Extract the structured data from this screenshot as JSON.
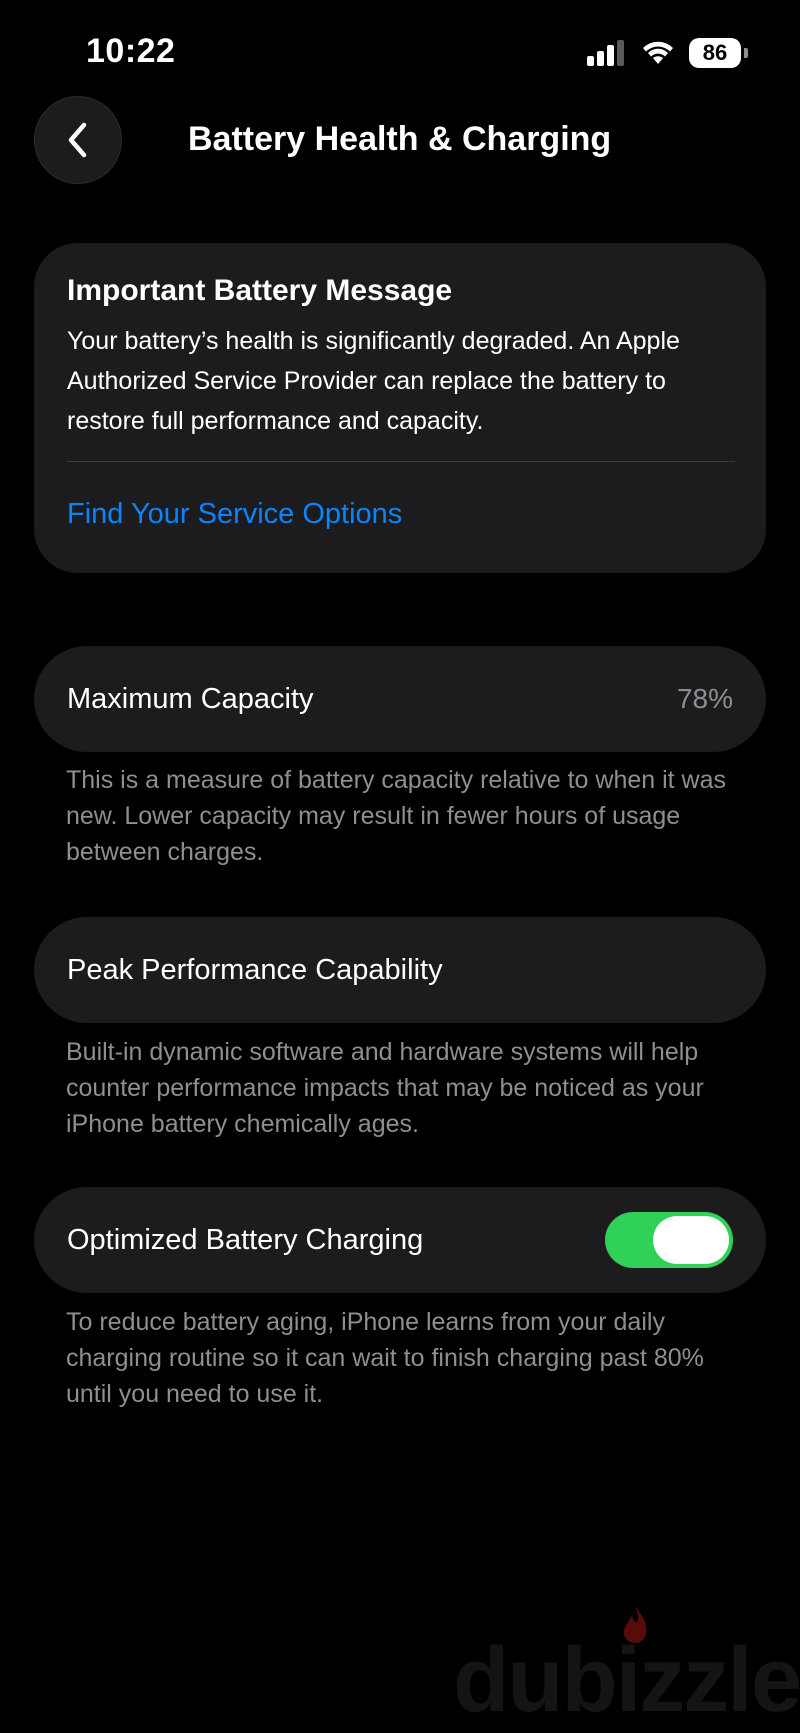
{
  "status_bar": {
    "time": "10:22",
    "battery_level": "86",
    "icons": [
      "signal-icon",
      "wifi-icon",
      "battery-icon"
    ]
  },
  "nav": {
    "back_icon": "chevron-left-icon",
    "title": "Battery Health & Charging"
  },
  "battery_message": {
    "title": "Important Battery Message",
    "body": "Your battery’s health is significantly degraded. An Apple Authorized Service Provider can replace the battery to restore full performance and capacity.",
    "link": "Find Your Service Options"
  },
  "maximum_capacity": {
    "label": "Maximum Capacity",
    "value": "78%",
    "caption": "This is a measure of battery capacity relative to when it was new. Lower capacity may result in fewer hours of usage between charges."
  },
  "peak_performance": {
    "label": "Peak Performance Capability",
    "caption": "Built-in dynamic software and hardware systems will help counter performance impacts that may be noticed as your iPhone battery chemically ages."
  },
  "optimized_charging": {
    "label": "Optimized Battery Charging",
    "enabled": true,
    "caption": "To reduce battery aging, iPhone learns from your daily charging routine so it can wait to finish charging past 80% until you need to use it."
  },
  "watermark": {
    "text": "dubizzle"
  },
  "colors": {
    "background": "#000000",
    "card": "#1c1c1e",
    "link": "#0a84ff",
    "toggle_on": "#30d158",
    "secondary_text": "#8e8e93"
  }
}
